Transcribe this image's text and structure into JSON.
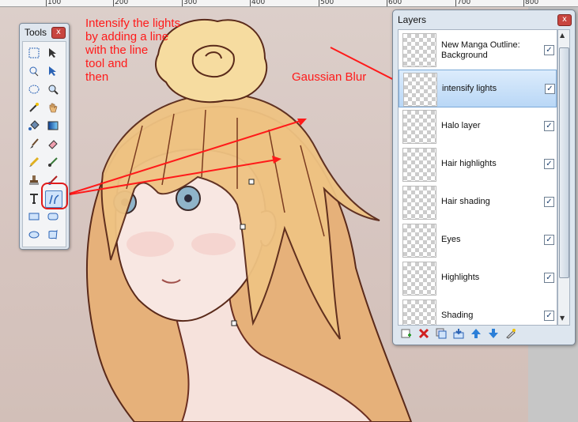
{
  "ruler": {
    "labels": [
      "100",
      "200",
      "300",
      "400",
      "500",
      "600",
      "700",
      "800"
    ]
  },
  "annotations": {
    "line_tool_note": "Intensify the lights\nby adding a line\nwith the line\ntool and\nthen",
    "blur_note": "Gaussian Blur"
  },
  "tools_window": {
    "title": "Tools",
    "close": "x"
  },
  "layers_window": {
    "title": "Layers",
    "close": "x",
    "layers": [
      {
        "name": "New Manga Outline:\nBackground",
        "checked": true,
        "selected": false
      },
      {
        "name": "intensify lights",
        "checked": true,
        "selected": true
      },
      {
        "name": "Halo layer",
        "checked": true,
        "selected": false
      },
      {
        "name": "Hair highlights",
        "checked": true,
        "selected": false
      },
      {
        "name": "Hair shading",
        "checked": true,
        "selected": false
      },
      {
        "name": "Eyes",
        "checked": true,
        "selected": false
      },
      {
        "name": "Highlights",
        "checked": true,
        "selected": false
      },
      {
        "name": "Shading",
        "checked": true,
        "selected": false
      }
    ],
    "check_glyph": "✓"
  },
  "colors": {
    "annotation_red": "#ff1a1a",
    "selection_blue": "#b9d7f6"
  }
}
